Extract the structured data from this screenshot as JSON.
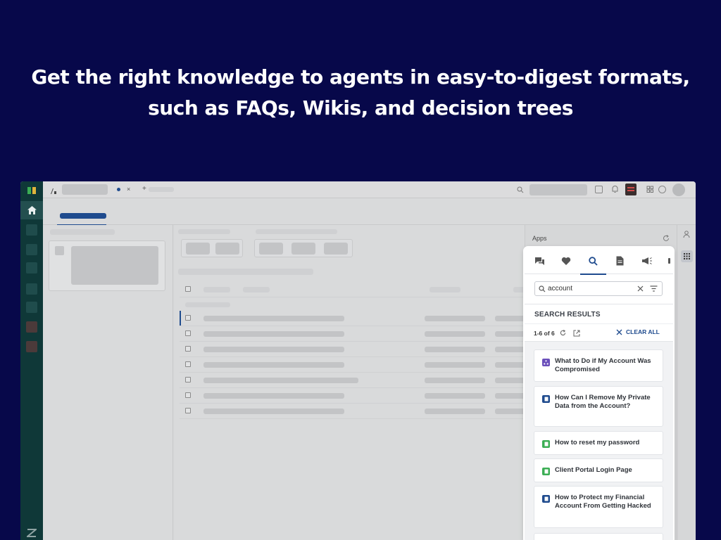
{
  "headline": {
    "line1": "Get the right knowledge to agents in easy-to-digest formats,",
    "line2": "such as FAQs, Wikis, and decision trees"
  },
  "apps_sidebar": {
    "title": "Apps"
  },
  "knowledge_panel": {
    "tabs": [
      {
        "icon": "chat-icon",
        "active": false
      },
      {
        "icon": "heart-icon",
        "active": false
      },
      {
        "icon": "search-icon",
        "active": true
      },
      {
        "icon": "document-icon",
        "active": false
      },
      {
        "icon": "megaphone-icon",
        "active": false
      }
    ],
    "search": {
      "value": "account"
    },
    "results_heading": "SEARCH RESULTS",
    "count_text": "1-6 of 6",
    "clear_all_label": "CLEAR ALL",
    "results": [
      {
        "title": "What to Do if My Account Was Compromised",
        "type": "decision-tree",
        "color": "#6b4fbb"
      },
      {
        "title": "How Can I Remove My Private Data from the Account?",
        "type": "faq",
        "color": "#1f4b8e"
      },
      {
        "title": "How to reset my password",
        "type": "wiki",
        "color": "#3cae55"
      },
      {
        "title": "Client Portal Login Page",
        "type": "wiki",
        "color": "#3cae55"
      },
      {
        "title": "How to Protect my Financial Account From Getting Hacked",
        "type": "faq",
        "color": "#1f4b8e"
      }
    ]
  },
  "colors": {
    "background": "#07084a",
    "accent": "#1f4b8e",
    "nav": "#0f3838"
  }
}
